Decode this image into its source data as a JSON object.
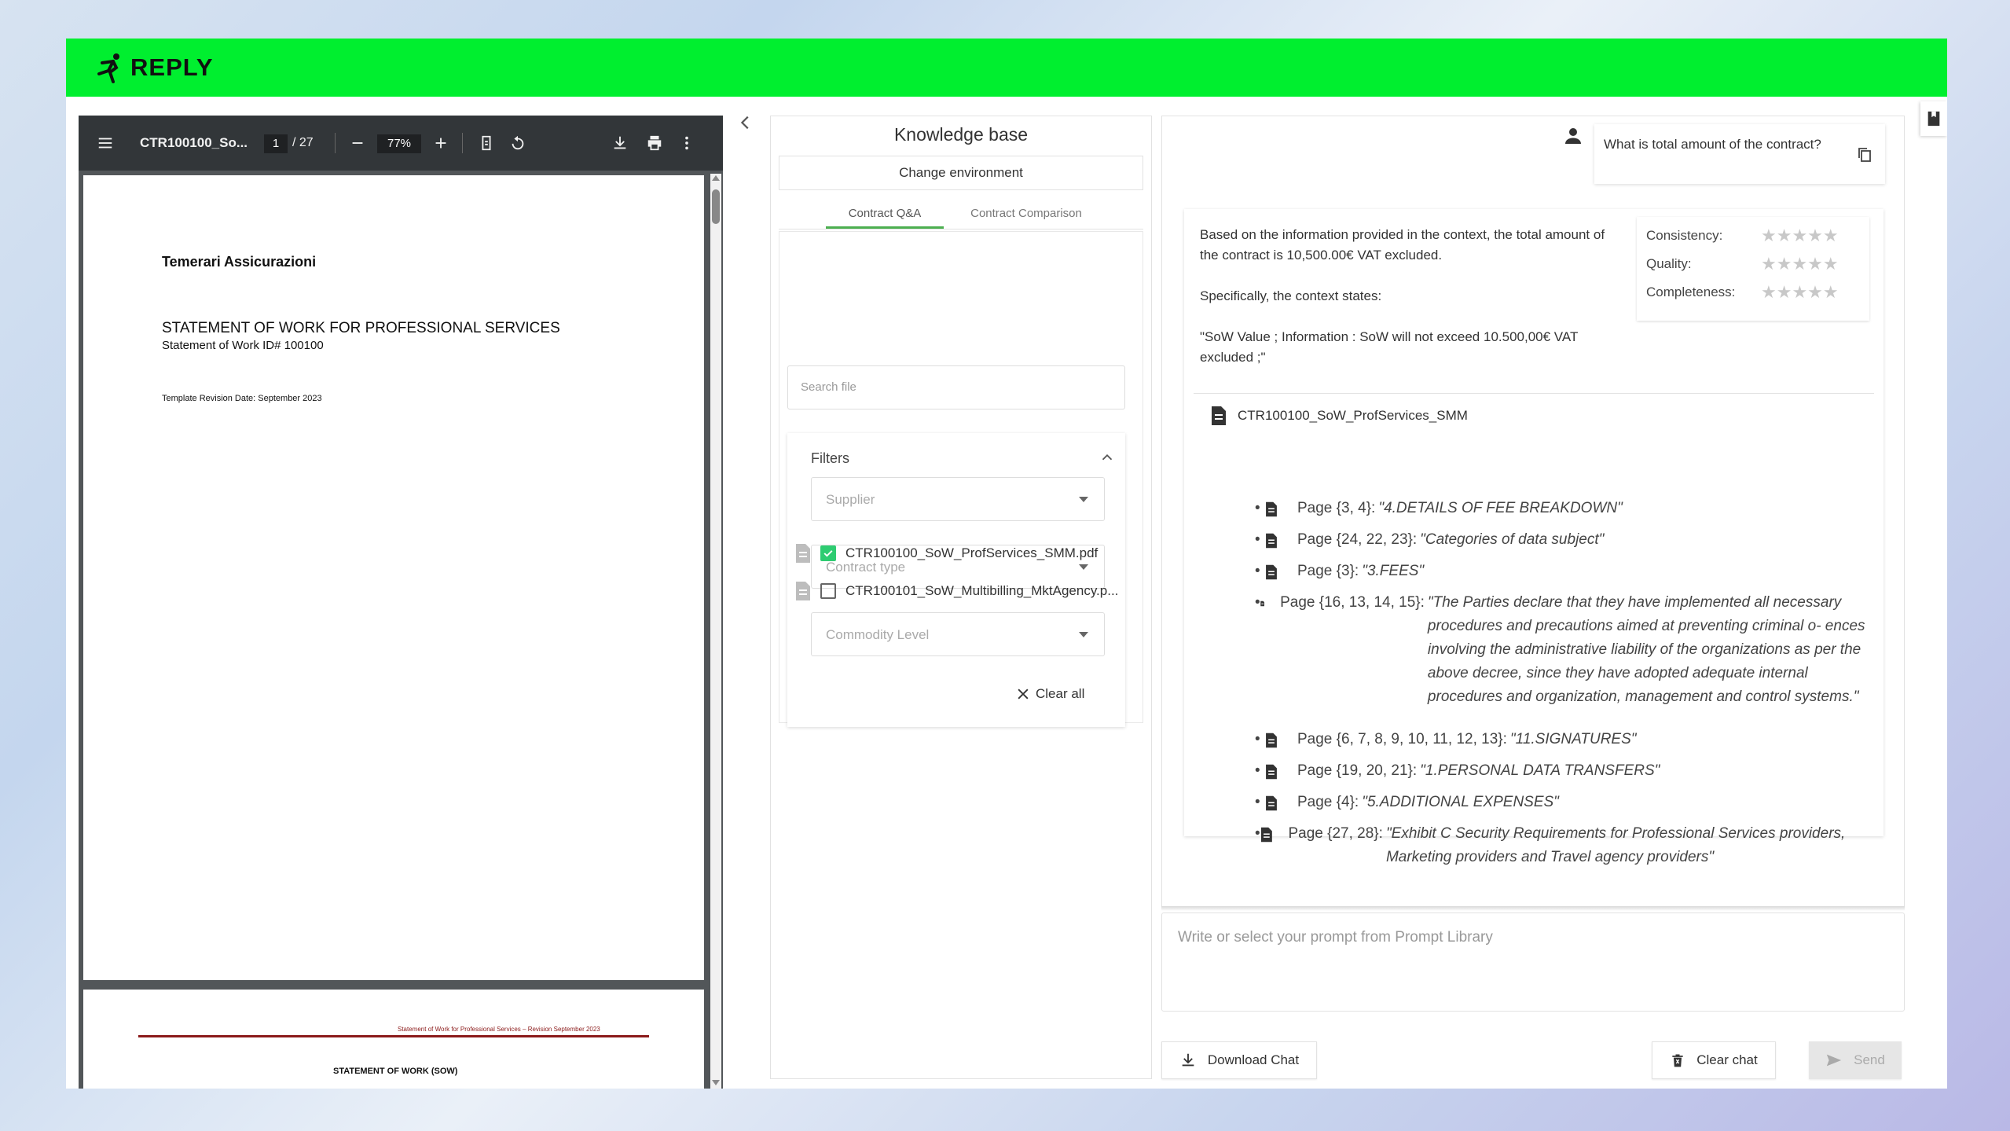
{
  "brand": {
    "logo_text": "REPLY",
    "accent": "#00ef2f"
  },
  "pdf_viewer": {
    "file_title": "CTR100100_So...",
    "current_page": "1",
    "total_pages": "/ 27",
    "zoom": "77%",
    "page1": {
      "company": "Temerari Assicurazioni",
      "heading": "STATEMENT OF WORK FOR PROFESSIONAL SERVICES",
      "subheading": "Statement of Work ID# 100100",
      "revision": "Template Revision Date: September 2023"
    },
    "page2": {
      "running_header": "Statement of Work for Professional Services – Revision September 2023",
      "title": "STATEMENT OF WORK (SOW)"
    }
  },
  "knowledge_base": {
    "title": "Knowledge base",
    "change_env": "Change environment",
    "tabs": [
      {
        "label": "Contract Q&A"
      },
      {
        "label": "Contract Comparison"
      }
    ],
    "search_placeholder": "Search file",
    "filters": {
      "label": "Filters",
      "supplier": "Supplier",
      "contract_type": "Contract type",
      "commodity": "Commodity Level",
      "clear_all": "Clear all"
    },
    "files": [
      {
        "name": "CTR100100_SoW_ProfServices_SMM.pdf",
        "checked": true
      },
      {
        "name": "CTR100101_SoW_Multibilling_MktAgency.p...",
        "checked": false
      }
    ]
  },
  "chat": {
    "user_question": "What is total amount of the contract?",
    "answer": [
      "Based on the information provided in the context, the total amount of the contract is 10,500.00€ VAT excluded.",
      "Specifically, the context states:",
      "\"SoW Value ; Information : SoW will not exceed 10.500,00€ VAT excluded ;\""
    ],
    "ratings": [
      {
        "label": "Consistency:",
        "stars": 0
      },
      {
        "label": "Quality:",
        "stars": 0
      },
      {
        "label": "Completeness:",
        "stars": 0
      }
    ],
    "source_doc": "CTR100100_SoW_ProfServices_SMM",
    "sources": [
      {
        "pages": "Page {3, 4}:",
        "quote": "\"4.DETAILS OF FEE BREAKDOWN\""
      },
      {
        "pages": "Page {24, 22, 23}:",
        "quote": "\"Categories of data subject\""
      },
      {
        "pages": "Page {3}:",
        "quote": "\"3.FEES\""
      },
      {
        "pages": "Page {16, 13, 14, 15}:",
        "quote": "\"The Parties declare that they have implemented all necessary procedures and precautions aimed at preventing criminal o- ences involving the administrative liability of the organizations as per the above decree, since they have adopted adequate internal procedures and organization, management and control systems.\""
      },
      {
        "pages": "Page {6, 7, 8, 9, 10, 11, 12, 13}:",
        "quote": "\"11.SIGNATURES\""
      },
      {
        "pages": "Page {19, 20, 21}:",
        "quote": "\"1.PERSONAL DATA TRANSFERS\""
      },
      {
        "pages": "Page {4}:",
        "quote": "\"5.ADDITIONAL EXPENSES\""
      },
      {
        "pages": "Page {27, 28}:",
        "quote": "\"Exhibit C Security Requirements for Professional Services providers, Marketing providers and Travel agency providers\""
      }
    ],
    "prompt_placeholder": "Write or select your prompt from Prompt Library",
    "download_label": "Download Chat",
    "clear_label": "Clear chat",
    "send_label": "Send"
  }
}
